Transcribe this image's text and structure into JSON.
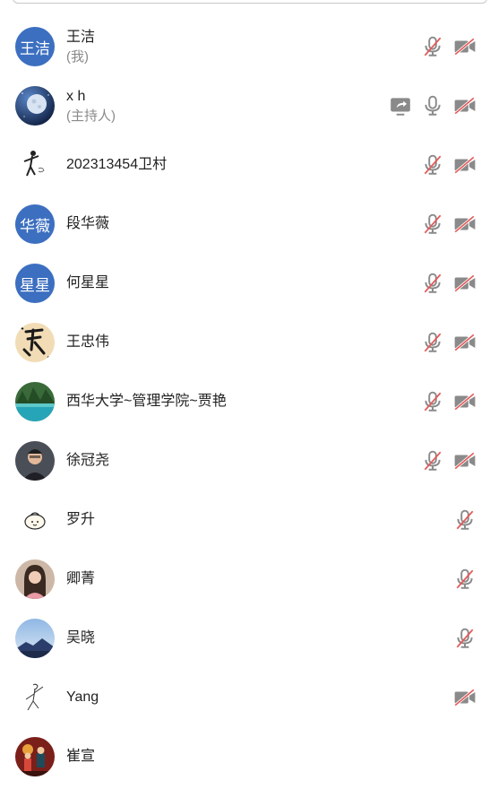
{
  "participants": [
    {
      "name": "王洁",
      "role": "(我)",
      "avatar_text": "王洁",
      "avatar_type": "text",
      "icons": [
        "mic-muted-icon",
        "camera-off-icon"
      ]
    },
    {
      "name": "x h",
      "role": "(主持人)",
      "avatar_type": "moon-photo",
      "icons": [
        "screen-share-icon",
        "mic-icon",
        "camera-off-icon"
      ]
    },
    {
      "name": "202313454卫村",
      "role": "",
      "avatar_type": "dancer-sketch",
      "icons": [
        "mic-muted-icon",
        "camera-off-icon"
      ]
    },
    {
      "name": "段华薇",
      "role": "",
      "avatar_text": "华薇",
      "avatar_type": "text",
      "icons": [
        "mic-muted-icon",
        "camera-off-icon"
      ]
    },
    {
      "name": "何星星",
      "role": "",
      "avatar_text": "星星",
      "avatar_type": "text",
      "icons": [
        "mic-muted-icon",
        "camera-off-icon"
      ]
    },
    {
      "name": "王忠伟",
      "role": "",
      "avatar_type": "calligraphy",
      "icons": [
        "mic-muted-icon",
        "camera-off-icon"
      ]
    },
    {
      "name": "西华大学~管理学院~贾艳",
      "role": "",
      "avatar_type": "lake-photo",
      "icons": [
        "mic-muted-icon",
        "camera-off-icon"
      ]
    },
    {
      "name": "徐冠尧",
      "role": "",
      "avatar_type": "portrait-man",
      "icons": [
        "mic-muted-icon",
        "camera-off-icon"
      ]
    },
    {
      "name": "罗升",
      "role": "",
      "avatar_type": "cartoon-bun",
      "icons": [
        "mic-muted-icon"
      ]
    },
    {
      "name": "卿菁",
      "role": "",
      "avatar_type": "portrait-woman",
      "icons": [
        "mic-muted-icon"
      ]
    },
    {
      "name": "吴晓",
      "role": "",
      "avatar_type": "mountain-photo",
      "icons": [
        "mic-muted-icon"
      ]
    },
    {
      "name": "Yang",
      "role": "",
      "avatar_type": "line-sketch",
      "icons": [
        "camera-off-icon"
      ]
    },
    {
      "name": "崔宣",
      "role": "",
      "avatar_type": "illustration",
      "icons": []
    }
  ],
  "colors": {
    "avatar_blue": "#3c6fc0",
    "icon_gray": "#8a8a8a",
    "mute_red": "#e35a5a"
  }
}
